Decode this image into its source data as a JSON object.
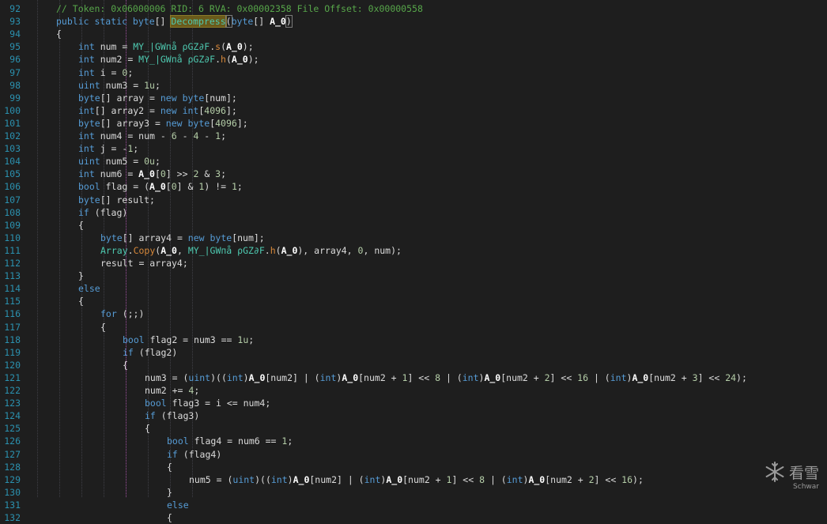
{
  "lines": [
    {
      "n": "92",
      "i": 1,
      "t": [
        {
          "c": "cm",
          "v": "// Token: 0x06000006 RID: 6 RVA: 0x00002358 File Offset: 0x00000558"
        }
      ]
    },
    {
      "n": "93",
      "i": 1,
      "t": [
        {
          "c": "kw",
          "v": "public static byte"
        },
        {
          "v": "[] "
        },
        {
          "c": "hl",
          "v": "Decompress"
        },
        {
          "c": "br",
          "v": "("
        },
        {
          "c": "kw",
          "v": "byte"
        },
        {
          "v": "[] "
        },
        {
          "c": "pa",
          "v": "A_0"
        },
        {
          "c": "br",
          "v": ")"
        }
      ]
    },
    {
      "n": "94",
      "i": 1,
      "t": [
        {
          "v": "{"
        }
      ]
    },
    {
      "n": "95",
      "i": 2,
      "t": [
        {
          "c": "kw",
          "v": "int"
        },
        {
          "v": " num = "
        },
        {
          "c": "ty",
          "v": "MY_|GWпå ρGZ∂F"
        },
        {
          "v": "."
        },
        {
          "c": "me",
          "v": "s"
        },
        {
          "v": "("
        },
        {
          "c": "pa",
          "v": "A_0"
        },
        {
          "v": ");"
        }
      ]
    },
    {
      "n": "96",
      "i": 2,
      "t": [
        {
          "c": "kw",
          "v": "int"
        },
        {
          "v": " num2 = "
        },
        {
          "c": "ty",
          "v": "MY_|GWпå ρGZ∂F"
        },
        {
          "v": "."
        },
        {
          "c": "me",
          "v": "h"
        },
        {
          "v": "("
        },
        {
          "c": "pa",
          "v": "A_0"
        },
        {
          "v": ");"
        }
      ]
    },
    {
      "n": "97",
      "i": 2,
      "t": [
        {
          "c": "kw",
          "v": "int"
        },
        {
          "v": " i = "
        },
        {
          "c": "num",
          "v": "0"
        },
        {
          "v": ";"
        }
      ]
    },
    {
      "n": "98",
      "i": 2,
      "t": [
        {
          "c": "kw",
          "v": "uint"
        },
        {
          "v": " num3 = "
        },
        {
          "c": "num",
          "v": "1u"
        },
        {
          "v": ";"
        }
      ]
    },
    {
      "n": "99",
      "i": 2,
      "t": [
        {
          "c": "kw",
          "v": "byte"
        },
        {
          "v": "[] array = "
        },
        {
          "c": "kw",
          "v": "new byte"
        },
        {
          "v": "[num];"
        }
      ]
    },
    {
      "n": "100",
      "i": 2,
      "t": [
        {
          "c": "kw",
          "v": "int"
        },
        {
          "v": "[] array2 = "
        },
        {
          "c": "kw",
          "v": "new int"
        },
        {
          "v": "["
        },
        {
          "c": "num",
          "v": "4096"
        },
        {
          "v": "];"
        }
      ]
    },
    {
      "n": "101",
      "i": 2,
      "t": [
        {
          "c": "kw",
          "v": "byte"
        },
        {
          "v": "[] array3 = "
        },
        {
          "c": "kw",
          "v": "new byte"
        },
        {
          "v": "["
        },
        {
          "c": "num",
          "v": "4096"
        },
        {
          "v": "];"
        }
      ]
    },
    {
      "n": "102",
      "i": 2,
      "t": [
        {
          "c": "kw",
          "v": "int"
        },
        {
          "v": " num4 = num - "
        },
        {
          "c": "num",
          "v": "6"
        },
        {
          "v": " - "
        },
        {
          "c": "num",
          "v": "4"
        },
        {
          "v": " - "
        },
        {
          "c": "num",
          "v": "1"
        },
        {
          "v": ";"
        }
      ]
    },
    {
      "n": "103",
      "i": 2,
      "t": [
        {
          "c": "kw",
          "v": "int"
        },
        {
          "v": " j = -"
        },
        {
          "c": "num",
          "v": "1"
        },
        {
          "v": ";"
        }
      ]
    },
    {
      "n": "104",
      "i": 2,
      "t": [
        {
          "c": "kw",
          "v": "uint"
        },
        {
          "v": " num5 = "
        },
        {
          "c": "num",
          "v": "0u"
        },
        {
          "v": ";"
        }
      ]
    },
    {
      "n": "105",
      "i": 2,
      "t": [
        {
          "c": "kw",
          "v": "int"
        },
        {
          "v": " num6 = "
        },
        {
          "c": "pa",
          "v": "A_0"
        },
        {
          "v": "["
        },
        {
          "c": "num",
          "v": "0"
        },
        {
          "v": "] >> "
        },
        {
          "c": "num",
          "v": "2"
        },
        {
          "v": " & "
        },
        {
          "c": "num",
          "v": "3"
        },
        {
          "v": ";"
        }
      ]
    },
    {
      "n": "106",
      "i": 2,
      "t": [
        {
          "c": "kw",
          "v": "bool"
        },
        {
          "v": " flag = ("
        },
        {
          "c": "pa",
          "v": "A_0"
        },
        {
          "v": "["
        },
        {
          "c": "num",
          "v": "0"
        },
        {
          "v": "] & "
        },
        {
          "c": "num",
          "v": "1"
        },
        {
          "v": ") != "
        },
        {
          "c": "num",
          "v": "1"
        },
        {
          "v": ";"
        }
      ]
    },
    {
      "n": "107",
      "i": 2,
      "t": [
        {
          "c": "kw",
          "v": "byte"
        },
        {
          "v": "[] result;"
        }
      ]
    },
    {
      "n": "108",
      "i": 2,
      "t": [
        {
          "c": "kw",
          "v": "if"
        },
        {
          "v": " (flag)"
        }
      ]
    },
    {
      "n": "109",
      "i": 2,
      "t": [
        {
          "v": "{"
        }
      ]
    },
    {
      "n": "110",
      "i": 3,
      "t": [
        {
          "c": "kw",
          "v": "byte"
        },
        {
          "v": "[] array4 = "
        },
        {
          "c": "kw",
          "v": "new byte"
        },
        {
          "v": "[num];"
        }
      ]
    },
    {
      "n": "111",
      "i": 3,
      "t": [
        {
          "c": "ty",
          "v": "Array"
        },
        {
          "v": "."
        },
        {
          "c": "me",
          "v": "Copy"
        },
        {
          "v": "("
        },
        {
          "c": "pa",
          "v": "A_0"
        },
        {
          "v": ", "
        },
        {
          "c": "ty",
          "v": "MY_|GWпå ρGZ∂F"
        },
        {
          "v": "."
        },
        {
          "c": "me",
          "v": "h"
        },
        {
          "v": "("
        },
        {
          "c": "pa",
          "v": "A_0"
        },
        {
          "v": "), array4, "
        },
        {
          "c": "num",
          "v": "0"
        },
        {
          "v": ", num);"
        }
      ]
    },
    {
      "n": "112",
      "i": 3,
      "t": [
        {
          "v": "result = array4;"
        }
      ]
    },
    {
      "n": "113",
      "i": 2,
      "t": [
        {
          "v": "}"
        }
      ]
    },
    {
      "n": "114",
      "i": 2,
      "t": [
        {
          "c": "kw",
          "v": "else"
        }
      ]
    },
    {
      "n": "115",
      "i": 2,
      "t": [
        {
          "v": "{"
        }
      ]
    },
    {
      "n": "116",
      "i": 3,
      "t": [
        {
          "c": "kw",
          "v": "for"
        },
        {
          "v": " (;;)"
        }
      ]
    },
    {
      "n": "117",
      "i": 3,
      "t": [
        {
          "v": "{"
        }
      ]
    },
    {
      "n": "118",
      "i": 4,
      "t": [
        {
          "c": "kw",
          "v": "bool"
        },
        {
          "v": " flag2 = num3 == "
        },
        {
          "c": "num",
          "v": "1u"
        },
        {
          "v": ";"
        }
      ]
    },
    {
      "n": "119",
      "i": 4,
      "t": [
        {
          "c": "kw",
          "v": "if"
        },
        {
          "v": " (flag2)"
        }
      ]
    },
    {
      "n": "120",
      "i": 4,
      "t": [
        {
          "v": "{"
        }
      ]
    },
    {
      "n": "121",
      "i": 5,
      "t": [
        {
          "v": "num3 = ("
        },
        {
          "c": "kw",
          "v": "uint"
        },
        {
          "v": ")(("
        },
        {
          "c": "kw",
          "v": "int"
        },
        {
          "v": ")"
        },
        {
          "c": "pa",
          "v": "A_0"
        },
        {
          "v": "[num2] | ("
        },
        {
          "c": "kw",
          "v": "int"
        },
        {
          "v": ")"
        },
        {
          "c": "pa",
          "v": "A_0"
        },
        {
          "v": "[num2 + "
        },
        {
          "c": "num",
          "v": "1"
        },
        {
          "v": "] << "
        },
        {
          "c": "num",
          "v": "8"
        },
        {
          "v": " | ("
        },
        {
          "c": "kw",
          "v": "int"
        },
        {
          "v": ")"
        },
        {
          "c": "pa",
          "v": "A_0"
        },
        {
          "v": "[num2 + "
        },
        {
          "c": "num",
          "v": "2"
        },
        {
          "v": "] << "
        },
        {
          "c": "num",
          "v": "16"
        },
        {
          "v": " | ("
        },
        {
          "c": "kw",
          "v": "int"
        },
        {
          "v": ")"
        },
        {
          "c": "pa",
          "v": "A_0"
        },
        {
          "v": "[num2 + "
        },
        {
          "c": "num",
          "v": "3"
        },
        {
          "v": "] << "
        },
        {
          "c": "num",
          "v": "24"
        },
        {
          "v": ");"
        }
      ]
    },
    {
      "n": "122",
      "i": 5,
      "t": [
        {
          "v": "num2 += "
        },
        {
          "c": "num",
          "v": "4"
        },
        {
          "v": ";"
        }
      ]
    },
    {
      "n": "123",
      "i": 5,
      "t": [
        {
          "c": "kw",
          "v": "bool"
        },
        {
          "v": " flag3 = i <= num4;"
        }
      ]
    },
    {
      "n": "124",
      "i": 5,
      "t": [
        {
          "c": "kw",
          "v": "if"
        },
        {
          "v": " (flag3)"
        }
      ]
    },
    {
      "n": "125",
      "i": 5,
      "t": [
        {
          "v": "{"
        }
      ]
    },
    {
      "n": "126",
      "i": 6,
      "t": [
        {
          "c": "kw",
          "v": "bool"
        },
        {
          "v": " flag4 = num6 == "
        },
        {
          "c": "num",
          "v": "1"
        },
        {
          "v": ";"
        }
      ]
    },
    {
      "n": "127",
      "i": 6,
      "t": [
        {
          "c": "kw",
          "v": "if"
        },
        {
          "v": " (flag4)"
        }
      ]
    },
    {
      "n": "128",
      "i": 6,
      "t": [
        {
          "v": "{"
        }
      ]
    },
    {
      "n": "129",
      "i": 7,
      "t": [
        {
          "v": "num5 = ("
        },
        {
          "c": "kw",
          "v": "uint"
        },
        {
          "v": ")(("
        },
        {
          "c": "kw",
          "v": "int"
        },
        {
          "v": ")"
        },
        {
          "c": "pa",
          "v": "A_0"
        },
        {
          "v": "[num2] | ("
        },
        {
          "c": "kw",
          "v": "int"
        },
        {
          "v": ")"
        },
        {
          "c": "pa",
          "v": "A_0"
        },
        {
          "v": "[num2 + "
        },
        {
          "c": "num",
          "v": "1"
        },
        {
          "v": "] << "
        },
        {
          "c": "num",
          "v": "8"
        },
        {
          "v": " | ("
        },
        {
          "c": "kw",
          "v": "int"
        },
        {
          "v": ")"
        },
        {
          "c": "pa",
          "v": "A_0"
        },
        {
          "v": "[num2 + "
        },
        {
          "c": "num",
          "v": "2"
        },
        {
          "v": "] << "
        },
        {
          "c": "num",
          "v": "16"
        },
        {
          "v": ");"
        }
      ]
    },
    {
      "n": "130",
      "i": 6,
      "t": [
        {
          "v": "}"
        }
      ]
    },
    {
      "n": "131",
      "i": 6,
      "t": [
        {
          "c": "kw",
          "v": "else"
        }
      ]
    },
    {
      "n": "132",
      "i": 6,
      "t": [
        {
          "v": "{"
        }
      ]
    }
  ],
  "watermark": {
    "text": "看雪",
    "sub": "Schwar",
    "icon": "snowflake-icon"
  }
}
